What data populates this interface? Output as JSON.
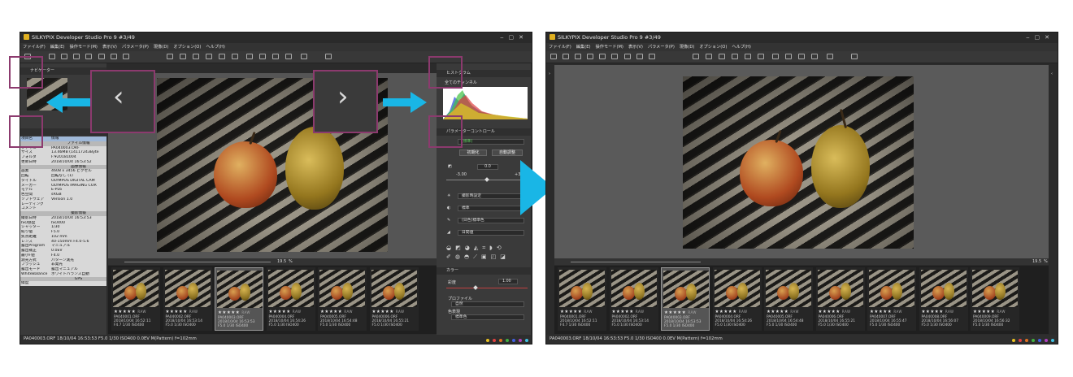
{
  "window_left": {
    "title": "SILKYPIX Developer Studio Pro 9   #3/49",
    "menu": [
      "ファイル(F)",
      "編集(E)",
      "操作モード(M)",
      "表示(V)",
      "パラメータ(P)",
      "現像(D)",
      "オプション(O)",
      "ヘルプ(H)"
    ],
    "navigator_label": "ナビゲーター",
    "info_headers": [
      "項目名",
      "情報"
    ],
    "file_section": "ファイル情報",
    "file_rows": [
      [
        "ファイル",
        "PA040003.ORF"
      ],
      [
        "サイズ",
        "13.46MB (14117243Byte"
      ],
      [
        "フォルダ",
        "F:¥20181004"
      ],
      [
        "更新日時",
        "2018/10/04 16:53:52"
      ]
    ],
    "image_section": "画像情報",
    "image_rows": [
      [
        "画素",
        "4608 x 3456 ピクセル"
      ],
      [
        "回転",
        "回転なし (1)"
      ],
      [
        "タイトル",
        "OLYMPUS DIGITAL CAM"
      ],
      [
        "メーカー",
        "OLYMPUS IMAGING COR"
      ],
      [
        "モデル",
        "E-PL6"
      ],
      [
        "色空間",
        "sRGB"
      ],
      [
        "ソフトウェア",
        "Version 1.0"
      ],
      [
        "レーティング",
        ""
      ],
      [
        "コメント",
        ""
      ]
    ],
    "shoot_section": "撮影情報",
    "shoot_rows": [
      [
        "撮影日時",
        "2018/10/04 16:53:53"
      ],
      [
        "ISO感度",
        "ISO400"
      ],
      [
        "シャッター",
        "1/30"
      ],
      [
        "絞り値",
        "F5.0"
      ],
      [
        "焦点距離",
        "102 mm"
      ],
      [
        "レンズ",
        "40-150mm F4.0-5.6"
      ],
      [
        "露出Program",
        "マニュアル"
      ],
      [
        "露出補正",
        "0.0EV"
      ],
      [
        "最小F値",
        "F4.0"
      ],
      [
        "測光方式",
        "パターン測光"
      ],
      [
        "フラッシュ",
        "非発光"
      ],
      [
        "露出モード",
        "露出マニュアル"
      ],
      [
        "WhiteBalance",
        "ホワイトバランス自動"
      ]
    ],
    "gps_section": "GPS",
    "gps_rows": [
      [
        "緯度",
        ""
      ]
    ],
    "zoom_value": "19.5",
    "zoom_unit": "%",
    "histogram_label": "ヒストグラム",
    "channel_label": "全てのチャンネル",
    "param_label": "パラメーターコントロール",
    "param_preset": "(標準)",
    "init_button": "初期化",
    "auto_button": "自動調整",
    "exposure_value": "0.0",
    "exposure_min": "-3.00",
    "exposure_max": "+3.00",
    "wb_select": "撮影時設定",
    "tone_select": "標準",
    "color_select": "(日色)標準色",
    "sharp_select": "日間値",
    "color_panel_label": "カラー",
    "saturation_label": "彩度",
    "saturation_value": "1.00",
    "profile_label": "プロファイル",
    "profile_value": "自然",
    "color_expr_label": "色表現",
    "color_expr_value": "標準色",
    "thumbnails": [
      {
        "name": "PA040001.ORF",
        "date": "2018/10/04 16:52:11",
        "exif": "F4.7 1/30 ISO400",
        "stars": "★★★★★",
        "badge": "RAW"
      },
      {
        "name": "PA040002.ORF",
        "date": "2018/10/04 16:53:14",
        "exif": "F5.0 1/30 ISO400",
        "stars": "★★★★★",
        "badge": "RAW"
      },
      {
        "name": "PA040003.ORF",
        "date": "2018/10/04 16:53:53",
        "exif": "F5.0 1/30 ISO400",
        "stars": "★★★★★",
        "badge": "RAW"
      },
      {
        "name": "PA040004.ORF",
        "date": "2018/10/04 16:54:26",
        "exif": "F5.0 1/30 ISO400",
        "stars": "★★★★★",
        "badge": "RAW"
      },
      {
        "name": "PA040005.ORF",
        "date": "2018/10/04 16:54:48",
        "exif": "F5.0 1/30 ISO400",
        "stars": "★★★★★",
        "badge": "RAW"
      },
      {
        "name": "PA040006.ORF",
        "date": "2018/10/04 16:55:21",
        "exif": "F5.0 1/30 ISO400",
        "stars": "★★★★★",
        "badge": "RAW"
      }
    ],
    "status": "PA040003.ORF 18/10/04 16:53:53 F5.0 1/30 ISO400  0.0EV M(Pattern) f=102mm"
  },
  "window_right": {
    "title": "SILKYPIX Developer Studio Pro 9   #3/49",
    "menu": [
      "ファイル(F)",
      "編集(E)",
      "操作モード(M)",
      "表示(V)",
      "パラメータ(P)",
      "現像(D)",
      "オプション(O)",
      "ヘルプ(H)"
    ],
    "zoom_value": "19.5",
    "zoom_unit": "%",
    "thumbnails": [
      {
        "name": "PA040001.ORF",
        "date": "2018/10/04 16:52:11",
        "exif": "F4.7 1/30 ISO400",
        "stars": "★★★★★",
        "badge": "RAW"
      },
      {
        "name": "PA040002.ORF",
        "date": "2018/10/04 16:53:14",
        "exif": "F5.0 1/30 ISO400",
        "stars": "★★★★★",
        "badge": "RAW"
      },
      {
        "name": "PA040003.ORF",
        "date": "2018/10/04 16:53:53",
        "exif": "F5.0 1/30 ISO400",
        "stars": "★★★★★",
        "badge": "RAW"
      },
      {
        "name": "PA040004.ORF",
        "date": "2018/10/04 16:54:26",
        "exif": "F5.0 1/30 ISO400",
        "stars": "★★★★★",
        "badge": "RAW"
      },
      {
        "name": "PA040005.ORF",
        "date": "2018/10/04 16:54:48",
        "exif": "F5.0 1/30 ISO400",
        "stars": "★★★★★",
        "badge": "RAW"
      },
      {
        "name": "PA040006.ORF",
        "date": "2018/10/04 16:55:21",
        "exif": "F5.0 1/30 ISO400",
        "stars": "★★★★★",
        "badge": "RAW"
      },
      {
        "name": "PA040007.ORF",
        "date": "2018/10/04 16:55:47",
        "exif": "F5.0 1/30 ISO400",
        "stars": "★★★★★",
        "badge": "RAW"
      },
      {
        "name": "PA040008.ORF",
        "date": "2018/10/04 16:56:07",
        "exif": "F5.0 1/30 ISO400",
        "stars": "★★★★★",
        "badge": "RAW"
      },
      {
        "name": "PA040009.ORF",
        "date": "2018/10/04 16:56:32",
        "exif": "F5.0 1/30 ISO400",
        "stars": "★★★★★",
        "badge": "RAW"
      }
    ],
    "status": "PA040003.ORF 18/10/04 16:53:53 F5.0 1/30 ISO400  0.0EV M(Pattern) f=102mm"
  },
  "colors": {
    "accent_arrow": "#19b6e6",
    "highlight_border": "#8c3a6e",
    "label_dots": [
      "#e8c020",
      "#e04040",
      "#e07020",
      "#40b040",
      "#4060e0",
      "#b040c0",
      "#40c0e0"
    ]
  }
}
